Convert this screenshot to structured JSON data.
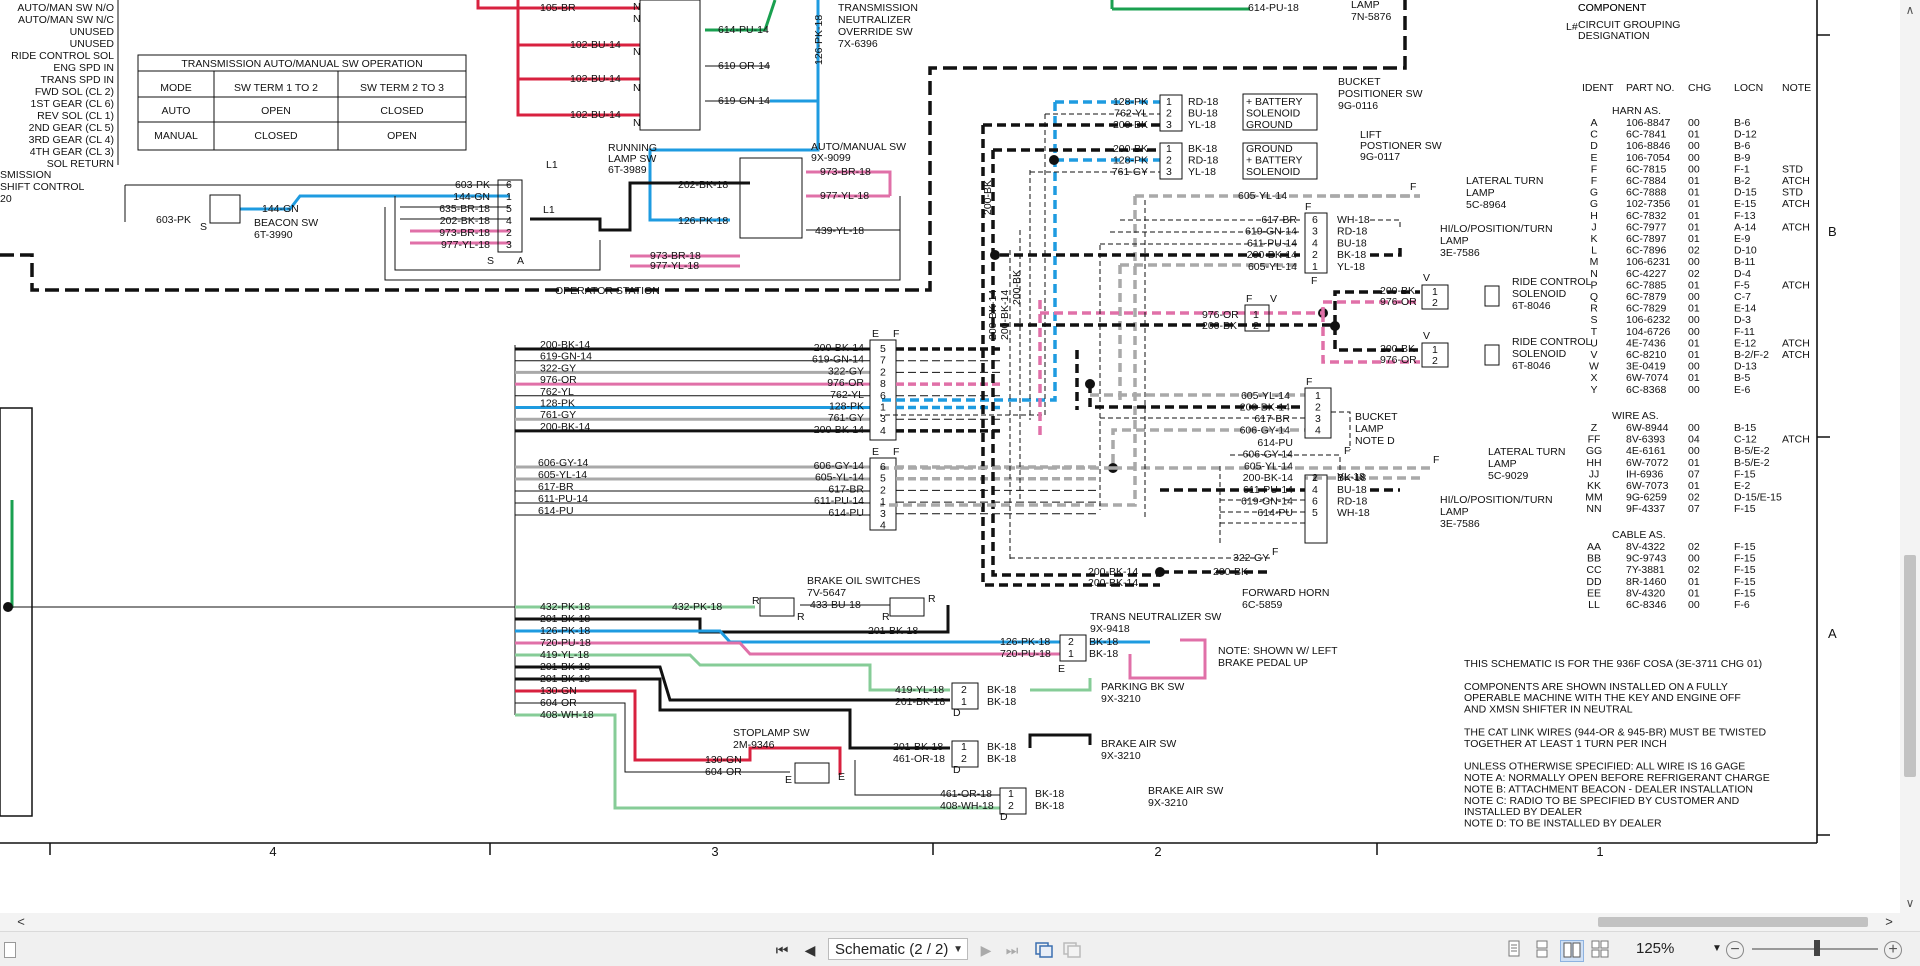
{
  "toolbar": {
    "first_page": "⏮",
    "prev_page": "◀",
    "page_label": "Schematic (2 / 2)",
    "next_page": "▶",
    "last_page": "⏭",
    "zoom": "125%",
    "zoom_out": "−",
    "zoom_in": "+"
  },
  "scroll": {
    "left_arrow": "<",
    "right_arrow": ">",
    "up_arrow": "∧",
    "down_arrow": "∨"
  },
  "schematic": {
    "left_labels": [
      "AUTO/MAN SW N/O",
      "AUTO/MAN SW N/C",
      "UNUSED",
      "UNUSED",
      "RIDE CONTROL SOL",
      "ENG SPD IN",
      "TRANS SPD IN",
      "FWD SOL (CL 2)",
      "1ST GEAR (CL 6)",
      "REV SOL (CL 1)",
      "2ND GEAR (CL 5)",
      "3RD GEAR (CL 4)",
      "4TH GEAR (CL 3)",
      "SOL RETURN"
    ],
    "left_cut": [
      "SMISSION",
      "SHIFT CONTROL",
      "20"
    ],
    "auto_table": {
      "title": "TRANSMISSION AUTO/MANUAL SW OPERATION",
      "headers": [
        "MODE",
        "SW TERM 1 TO 2",
        "SW TERM 2 TO 3"
      ],
      "rows": [
        [
          "AUTO",
          "OPEN",
          "CLOSED"
        ],
        [
          "MANUAL",
          "CLOSED",
          "OPEN"
        ]
      ]
    },
    "components": [
      {
        "name": "TRANSMISSION NEUTRALIZER OVERRIDE SW",
        "part": "7X-6396"
      },
      {
        "name": "LAMP",
        "part": "7N-5876"
      },
      {
        "name": "RUNNING LAMP SW",
        "part": "6T-3989"
      },
      {
        "name": "AUTO/MANUAL SW",
        "part": "9X-9099"
      },
      {
        "name": "BEACON SW",
        "part": "6T-3990"
      },
      {
        "name": "BUCKET POSITIONER SW",
        "part": "9G-0116"
      },
      {
        "name": "LIFT POSTIONER SW",
        "part": "9G-0117"
      },
      {
        "name": "LATERAL TURN LAMP",
        "part": "5C-8964"
      },
      {
        "name": "HI/LO/POSITION/TURN LAMP",
        "part": "3E-7586"
      },
      {
        "name": "RIDE CONTROL SOLENOID",
        "part": "6T-8046"
      },
      {
        "name": "RIDE CONTROL SOLENOID",
        "part": "6T-8046"
      },
      {
        "name": "BUCKET LAMP NOTE D",
        "part": ""
      },
      {
        "name": "LATERAL TURN LAMP",
        "part": "5C-9029"
      },
      {
        "name": "HI/LO/POSITION/TURN LAMP",
        "part": "3E-7586"
      },
      {
        "name": "FORWARD HORN",
        "part": "6C-5859"
      },
      {
        "name": "BRAKE OIL SWITCHES",
        "part": "7V-5647"
      },
      {
        "name": "TRANS NEUTRALIZER SW",
        "part": "9X-9418"
      },
      {
        "name": "PARKING BK SW",
        "part": "9X-3210"
      },
      {
        "name": "STOPLAMP SW",
        "part": "2M-9346"
      },
      {
        "name": "BRAKE AIR SW",
        "part": "9X-3210"
      },
      {
        "name": "BRAKE AIR SW",
        "part": "9X-3210"
      }
    ],
    "operator_station": "OPERATOR STATION",
    "note_left_pedal": [
      "NOTE: SHOWN W/ LEFT",
      "BRAKE PEDAL UP"
    ],
    "legend_top": [
      "COMPONENT",
      "CIRCUIT GROUPING",
      "DESIGNATION",
      "L#"
    ],
    "harness_table": {
      "headers": [
        "IDENT",
        "PART NO.",
        "CHG",
        "LOCN",
        "NOTE"
      ],
      "harn_title": "HARN AS.",
      "harn": [
        [
          "A",
          "106-8847",
          "00",
          "B-6",
          ""
        ],
        [
          "C",
          "6C-7841",
          "01",
          "D-12",
          ""
        ],
        [
          "D",
          "106-8846",
          "00",
          "B-6",
          ""
        ],
        [
          "E",
          "106-7054",
          "00",
          "B-9",
          ""
        ],
        [
          "F",
          "6C-7815",
          "00",
          "F-1",
          "STD"
        ],
        [
          "F",
          "6C-7884",
          "01",
          "B-2",
          "ATCH"
        ],
        [
          "G",
          "6C-7888",
          "01",
          "D-15",
          "STD"
        ],
        [
          "G",
          "102-7356",
          "01",
          "E-15",
          "ATCH"
        ],
        [
          "H",
          "6C-7832",
          "01",
          "F-13",
          ""
        ],
        [
          "J",
          "6C-7977",
          "01",
          "A-14",
          "ATCH"
        ],
        [
          "K",
          "6C-7897",
          "01",
          "E-9",
          ""
        ],
        [
          "L",
          "6C-7896",
          "02",
          "D-10",
          ""
        ],
        [
          "M",
          "106-6231",
          "00",
          "B-11",
          ""
        ],
        [
          "N",
          "6C-4227",
          "02",
          "D-4",
          ""
        ],
        [
          "P",
          "6C-7885",
          "01",
          "F-5",
          "ATCH"
        ],
        [
          "Q",
          "6C-7879",
          "00",
          "C-7",
          ""
        ],
        [
          "R",
          "6C-7829",
          "01",
          "E-14",
          ""
        ],
        [
          "S",
          "106-6232",
          "00",
          "D-3",
          ""
        ],
        [
          "T",
          "104-6726",
          "00",
          "F-11",
          ""
        ],
        [
          "U",
          "4E-7436",
          "01",
          "E-12",
          "ATCH"
        ],
        [
          "V",
          "6C-8210",
          "01",
          "B-2/F-2",
          "ATCH"
        ],
        [
          "W",
          "3E-0419",
          "00",
          "D-13",
          ""
        ],
        [
          "X",
          "6W-7074",
          "01",
          "B-5",
          ""
        ],
        [
          "Y",
          "6C-8368",
          "00",
          "E-6",
          ""
        ]
      ],
      "wire_title": "WIRE AS.",
      "wire": [
        [
          "Z",
          "6W-8944",
          "00",
          "B-15",
          ""
        ],
        [
          "FF",
          "8V-6393",
          "04",
          "C-12",
          "ATCH"
        ],
        [
          "GG",
          "4E-6161",
          "00",
          "B-5/E-2",
          ""
        ],
        [
          "HH",
          "6W-7072",
          "01",
          "B-5/E-2",
          ""
        ],
        [
          "JJ",
          "IH-6936",
          "07",
          "F-15",
          ""
        ],
        [
          "KK",
          "6W-7073",
          "01",
          "E-2",
          ""
        ],
        [
          "MM",
          "9G-6259",
          "02",
          "D-15/E-15",
          ""
        ],
        [
          "NN",
          "9F-4337",
          "07",
          "F-15",
          ""
        ]
      ],
      "cable_title": "CABLE AS.",
      "cable": [
        [
          "AA",
          "8V-4322",
          "02",
          "F-15",
          ""
        ],
        [
          "BB",
          "9C-9743",
          "00",
          "F-15",
          ""
        ],
        [
          "CC",
          "7Y-3881",
          "02",
          "F-15",
          ""
        ],
        [
          "DD",
          "8R-1460",
          "01",
          "F-15",
          ""
        ],
        [
          "EE",
          "8V-4320",
          "01",
          "F-15",
          ""
        ],
        [
          "LL",
          "6C-8346",
          "00",
          "F-6",
          ""
        ]
      ]
    },
    "notes": [
      "THIS SCHEMATIC IS FOR THE 936F COSA (3E-3711 CHG 01)",
      "",
      "COMPONENTS ARE SHOWN INSTALLED ON A FULLY",
      "OPERABLE MACHINE WITH THE KEY AND ENGINE OFF",
      "AND XMSN SHIFTER IN NEUTRAL",
      "",
      "THE CAT LINK WIRES (944-OR & 945-BR) MUST BE TWISTED",
      "TOGETHER AT LEAST 1 TURN PER INCH",
      "",
      "UNLESS OTHERWISE SPECIFIED: ALL WIRE IS 16 GAGE",
      "NOTE A: NORMALLY OPEN BEFORE REFRIGERANT CHARGE",
      "NOTE B: ATTACHMENT BEACON - DEALER INSTALLATION",
      "NOTE C: RADIO TO BE SPECIFIED BY CUSTOMER AND",
      "             INSTALLED BY DEALER",
      "NOTE D: TO BE INSTALLED BY DEALER"
    ],
    "grid_cols": [
      "4",
      "3",
      "2",
      "1"
    ],
    "grid_rows": [
      "B",
      "A"
    ],
    "wires_left_a": [
      "200-BK-14",
      "619-GN-14",
      "322-GY",
      "976-OR",
      "762-YL",
      "128-PK",
      "761-GY",
      "200-BK-14"
    ],
    "wires_left_b": [
      "606-GY-14",
      "605-YL-14",
      "617-BR",
      "611-PU-14",
      "614-PU"
    ],
    "wires_left_c": [
      "432-PK-18",
      "201-BK-18",
      "126-PK-18",
      "720-PU-18",
      "419-YL-18",
      "201-BK-18",
      "201-BK-18",
      "130-GN",
      "604-OR",
      "408-WH-18"
    ],
    "conn_a": [
      [
        "200-BK-14",
        "5"
      ],
      [
        "619-GN-14",
        "7"
      ],
      [
        "322-GY",
        "2"
      ],
      [
        "976-OR",
        "8"
      ],
      [
        "762-YL",
        "6"
      ],
      [
        "128-PK",
        "1"
      ],
      [
        "761-GY",
        "3"
      ],
      [
        "200-BK-14",
        "4"
      ]
    ],
    "conn_b": [
      [
        "606-GY-14",
        "6"
      ],
      [
        "605-YL-14",
        "5"
      ],
      [
        "617-BR",
        "2"
      ],
      [
        "611-PU-14",
        "1"
      ],
      [
        "614-PU",
        "3"
      ],
      [
        "",
        "4"
      ]
    ],
    "top_wires": [
      "105-BR",
      "102-BU-14",
      "102-BU-14",
      "102-BU-14",
      "614-PU-14",
      "610-OR-14",
      "619-GN-14",
      "126-PK-18",
      "614-PU-18"
    ],
    "beacon_wires": [
      "603-PK",
      "144-GN",
      "635-BR-18",
      "202-BK-18",
      "973-BR-18",
      "977-YL-18"
    ],
    "beacon_pins": [
      "6",
      "1",
      "5",
      "4",
      "2",
      "3"
    ],
    "running_wires": [
      "202-BK-18",
      "126-PK-18",
      "973-BR-18",
      "977-YL-18",
      "439-YL-18",
      "973-BR-18",
      "977-YL-18"
    ],
    "positioner_a": [
      [
        "128-PK",
        "1",
        "RD-18",
        "+ BATTERY"
      ],
      [
        "762-YL",
        "2",
        "BU-18",
        "SOLENOID"
      ],
      [
        "200-BK",
        "3",
        "YL-18",
        "GROUND"
      ]
    ],
    "positioner_b": [
      [
        "200-BK",
        "1",
        "BK-18",
        "GROUND"
      ],
      [
        "128-PK",
        "2",
        "RD-18",
        "+ BATTERY"
      ],
      [
        "761-GY",
        "3",
        "YL-18",
        "SOLENOID"
      ]
    ],
    "lamp1": [
      [
        "617-BR",
        "6",
        "WH-18"
      ],
      [
        "619-GN-14",
        "3",
        "RD-18"
      ],
      [
        "611-PU-14",
        "4",
        "BU-18"
      ],
      [
        "200-BK-14",
        "2",
        "BK-18"
      ],
      [
        "605-YL-14",
        "1",
        "YL-18"
      ]
    ],
    "ride_wires": [
      "200-BK",
      "976-OR",
      "976-OR",
      "200-BK",
      "200-BK",
      "976-OR"
    ],
    "bucket_wires": [
      [
        "605-YL-14",
        "1"
      ],
      [
        "200-BK-14",
        "2"
      ],
      [
        "617-BR",
        "3"
      ],
      [
        "606-GY-14",
        "4"
      ]
    ],
    "lamp2": [
      [
        "614-PU",
        ""
      ],
      [
        "606-GY-14",
        ""
      ],
      [
        "605-YL-14",
        ""
      ],
      [
        "200-BK-14",
        "2",
        "BK-18"
      ],
      [
        "611-PU-14",
        "4",
        "BU-18"
      ],
      [
        "619-GN-14",
        "6",
        "RD-18"
      ],
      [
        "614-PU",
        "5",
        "WH-18"
      ]
    ],
    "lamp2_yl": "YL-18",
    "other_wires": [
      "605-YL-14",
      "200-BK",
      "200-BK",
      "322-GY",
      "200-BK-14",
      "200-BK",
      "200-BK-14",
      "200-BK-14",
      "200-BK"
    ],
    "brake_wires": [
      "432-PK-18",
      "433-BU-18",
      "201-BK-18",
      "126-PK-18",
      "720-PU-18",
      "BK-18",
      "BK-18",
      "419-YL-18",
      "201-BK-18",
      "BK-18",
      "BK-18",
      "130-GN",
      "604-OR",
      "201-BK-18",
      "461-OR-18",
      "BK-18",
      "BK-18",
      "461-OR-18",
      "408-WH-18",
      "BK-18",
      "BK-18"
    ],
    "misc_letters": [
      "N",
      "S",
      "L1",
      "E",
      "F",
      "V",
      "R",
      "D",
      "A"
    ],
    "colors": {
      "black": "#111111",
      "pink": "#e070a8",
      "red": "#d8213f",
      "green": "#1aa050",
      "ltgreen": "#86cc97",
      "blue": "#1e9be0",
      "gray": "#a9a9a9"
    }
  }
}
